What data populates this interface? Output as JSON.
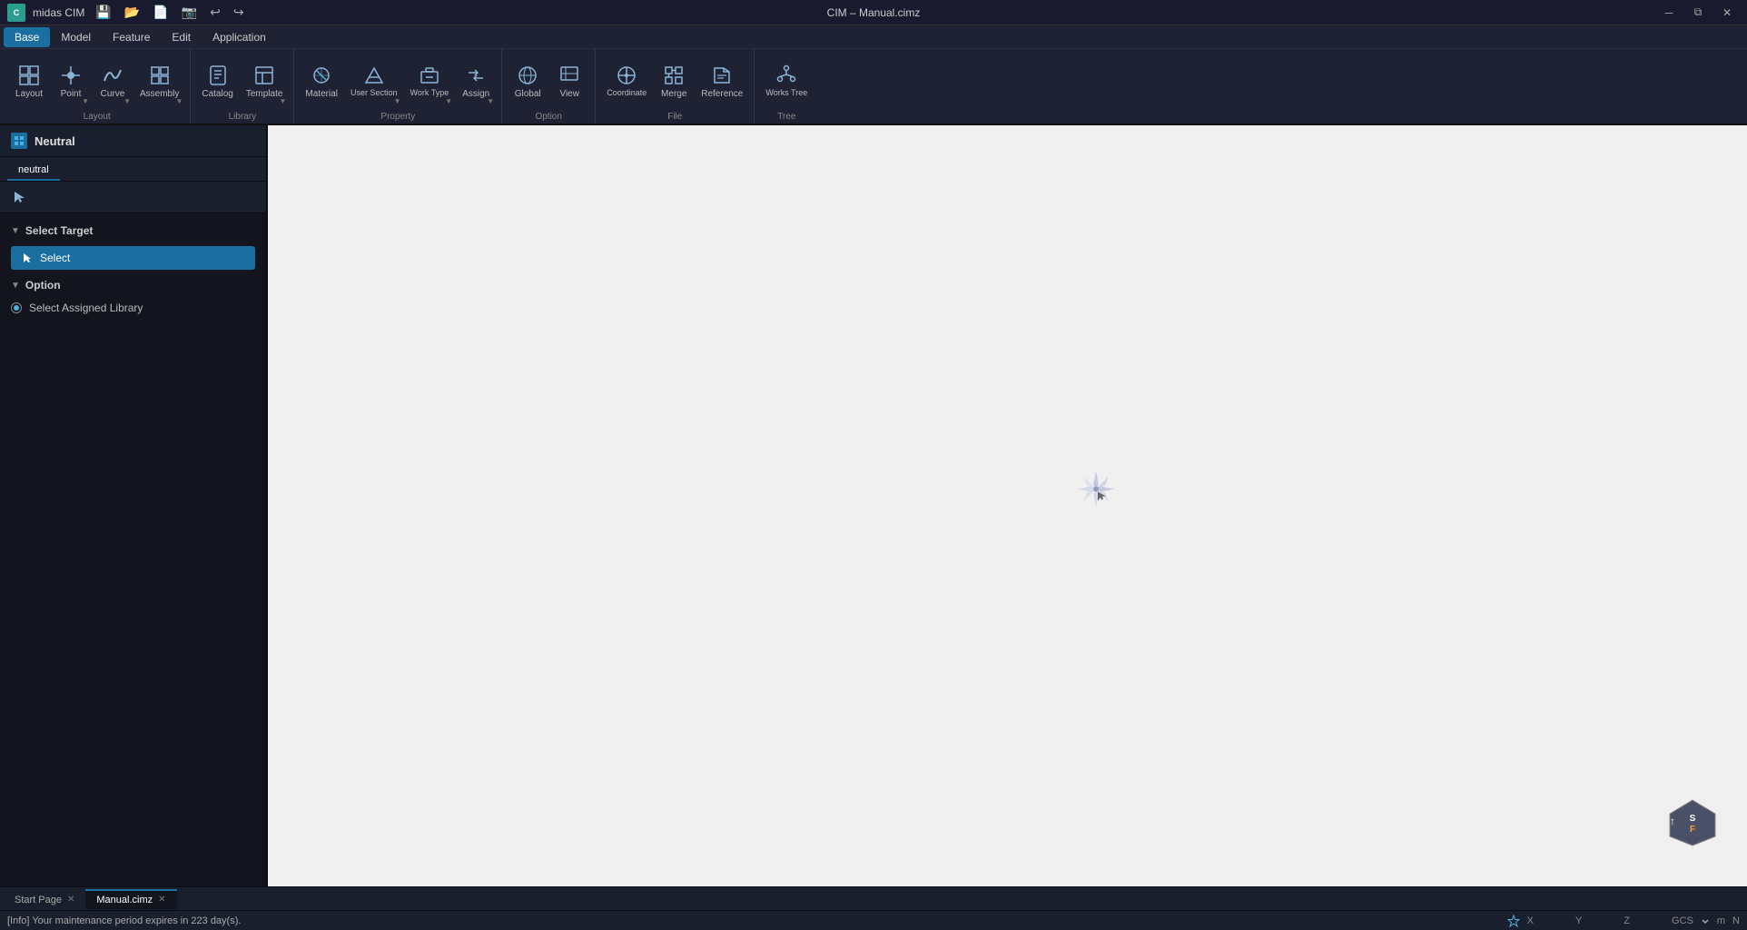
{
  "app": {
    "name": "midas CIM",
    "window_title": "CIM – Manual.cimz"
  },
  "title_bar": {
    "icons": [
      "save-icon",
      "open-icon",
      "saveas-icon",
      "screenshot-icon",
      "undo-icon",
      "redo-icon"
    ],
    "window_controls": [
      "minimize",
      "restore",
      "close"
    ]
  },
  "menu_bar": {
    "items": [
      "Base",
      "Model",
      "Feature",
      "Edit",
      "Application"
    ],
    "active": "Base"
  },
  "ribbon": {
    "groups": [
      {
        "label": "Layout",
        "buttons": [
          {
            "id": "layout",
            "icon": "⊞",
            "label": "Layout",
            "has_arrow": false
          },
          {
            "id": "point",
            "icon": "⊙",
            "label": "Point",
            "has_arrow": true
          },
          {
            "id": "curve",
            "icon": "⌒",
            "label": "Curve",
            "has_arrow": true
          },
          {
            "id": "assembly",
            "icon": "⊠",
            "label": "Assembly",
            "has_arrow": true
          }
        ]
      },
      {
        "label": "Library",
        "buttons": [
          {
            "id": "catalog",
            "icon": "▤",
            "label": "Catalog",
            "has_arrow": false
          },
          {
            "id": "template",
            "icon": "⊡",
            "label": "Template",
            "has_arrow": true
          }
        ]
      },
      {
        "label": "Property",
        "buttons": [
          {
            "id": "material",
            "icon": "◈",
            "label": "Material",
            "has_arrow": false
          },
          {
            "id": "usersection",
            "icon": "⊿",
            "label": "User Section",
            "has_arrow": true
          },
          {
            "id": "worktype",
            "icon": "⊟",
            "label": "Work Type",
            "has_arrow": true
          },
          {
            "id": "assign",
            "icon": "⇌",
            "label": "Assign",
            "has_arrow": true
          }
        ]
      },
      {
        "label": "Option",
        "buttons": [
          {
            "id": "global",
            "icon": "⚙",
            "label": "Global",
            "has_arrow": false
          },
          {
            "id": "view",
            "icon": "◫",
            "label": "View",
            "has_arrow": false
          }
        ]
      },
      {
        "label": "File",
        "buttons": [
          {
            "id": "coordinate",
            "icon": "⊕",
            "label": "Coordinate",
            "has_arrow": false
          },
          {
            "id": "merge",
            "icon": "⊎",
            "label": "Merge",
            "has_arrow": false
          },
          {
            "id": "reference",
            "icon": "📁",
            "label": "Reference",
            "has_arrow": false
          }
        ]
      },
      {
        "label": "Tree",
        "buttons": [
          {
            "id": "workstree",
            "icon": "🌳",
            "label": "Works Tree",
            "has_arrow": false
          }
        ]
      }
    ]
  },
  "left_panel": {
    "title": "Neutral",
    "tab": "neutral",
    "sections": [
      {
        "id": "select-target",
        "label": "Select Target",
        "expanded": true,
        "buttons": [
          {
            "id": "select",
            "label": "Select"
          }
        ]
      },
      {
        "id": "option",
        "label": "Option",
        "expanded": true,
        "options": [
          {
            "id": "select-assigned-library",
            "label": "Select Assigned Library",
            "active": true
          }
        ]
      }
    ]
  },
  "viewport": {
    "background": "#f0f0f0"
  },
  "bottom_tabs": [
    {
      "label": "Start Page",
      "active": false,
      "closable": true
    },
    {
      "label": "Manual.cimz",
      "active": true,
      "closable": true
    }
  ],
  "status_bar": {
    "message": "[Info] Your maintenance period expires in 223 day(s).",
    "coords": {
      "x_label": "X",
      "x_value": "",
      "y_label": "Y",
      "y_value": "",
      "z_label": "Z",
      "z_value": "",
      "gcs_label": "GCS",
      "m_label": "m",
      "n_label": "N"
    }
  }
}
